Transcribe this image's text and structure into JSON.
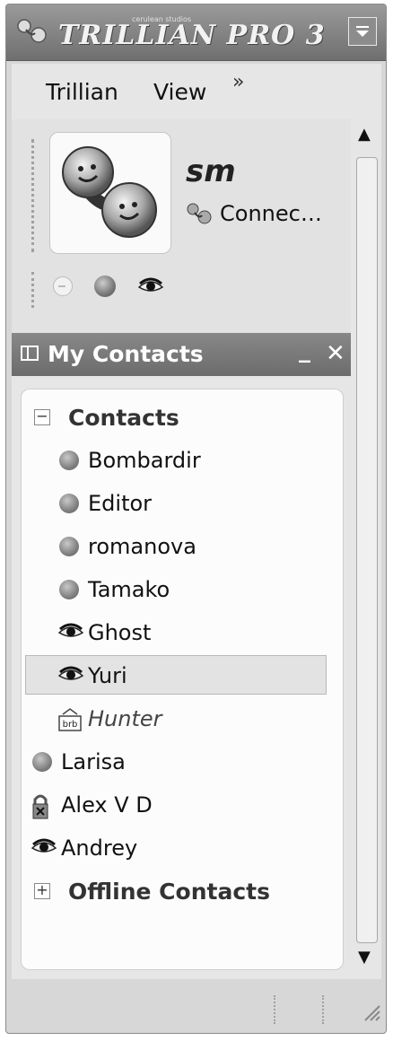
{
  "title_bar": {
    "logo_text": "TRILLIAN PRO 3",
    "logo_subtext": "cerulean studios",
    "menu_icon": "dropdown-menu-icon"
  },
  "menubar": {
    "items": [
      "Trillian",
      "View"
    ],
    "overflow": "»"
  },
  "profile": {
    "name": "sm",
    "status_text": "Connec…",
    "avatar_icon": "trillian-smiley-avatar-icon"
  },
  "contacts_window": {
    "title": "My Contacts",
    "minimize": "_",
    "close": "✕"
  },
  "contacts": [
    {
      "type": "group",
      "toggle": "−",
      "label": "Contacts"
    },
    {
      "type": "contact",
      "label": "Bombardir",
      "icon": "status-ball-icon"
    },
    {
      "type": "contact",
      "label": "Editor",
      "icon": "status-ball-icon"
    },
    {
      "type": "contact",
      "label": "romanova",
      "icon": "status-ball-icon"
    },
    {
      "type": "contact",
      "label": "Tamako",
      "icon": "status-ball-icon"
    },
    {
      "type": "contact",
      "label": "Ghost",
      "icon": "eye-icon"
    },
    {
      "type": "contact",
      "label": "Yuri",
      "icon": "eye-icon",
      "selected": true
    },
    {
      "type": "contact",
      "label": "Hunter",
      "icon": "brb-icon",
      "italic": true
    },
    {
      "type": "contact",
      "label": "Larisa",
      "icon": "status-ball-icon"
    },
    {
      "type": "contact",
      "label": "Alex V D",
      "icon": "lock-icon"
    },
    {
      "type": "contact",
      "label": "Andrey",
      "icon": "eye-icon"
    },
    {
      "type": "group",
      "toggle": "+",
      "label": "Offline Contacts"
    }
  ],
  "colors": {
    "frame": "#d7d7d7",
    "title_bar": "#7a7a7a",
    "list_bg": "#fcfcfc",
    "selection": "#e3e3e3"
  }
}
